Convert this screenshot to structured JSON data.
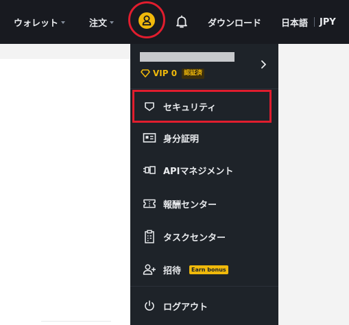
{
  "nav": {
    "wallet": "ウォレット",
    "order": "注文",
    "download": "ダウンロード",
    "language": "日本語",
    "currency": "JPY"
  },
  "dropdown": {
    "vip_label": "VIP 0",
    "verified_badge": "認証済",
    "items": [
      {
        "label": "セキュリティ",
        "icon": "shield-icon"
      },
      {
        "label": "身分証明",
        "icon": "id-card-icon"
      },
      {
        "label": "APIマネジメント",
        "icon": "api-plug-icon"
      },
      {
        "label": "報酬センター",
        "icon": "ticket-icon"
      },
      {
        "label": "タスクセンター",
        "icon": "clipboard-icon"
      },
      {
        "label": "招待",
        "icon": "add-user-icon",
        "badge": "Earn bonus"
      },
      {
        "label": "ログアウト",
        "icon": "power-icon"
      }
    ]
  },
  "colors": {
    "topbar_bg": "#181a20",
    "dropdown_bg": "#1e2329",
    "accent": "#f0b90b",
    "annotation": "#e11d2e"
  }
}
